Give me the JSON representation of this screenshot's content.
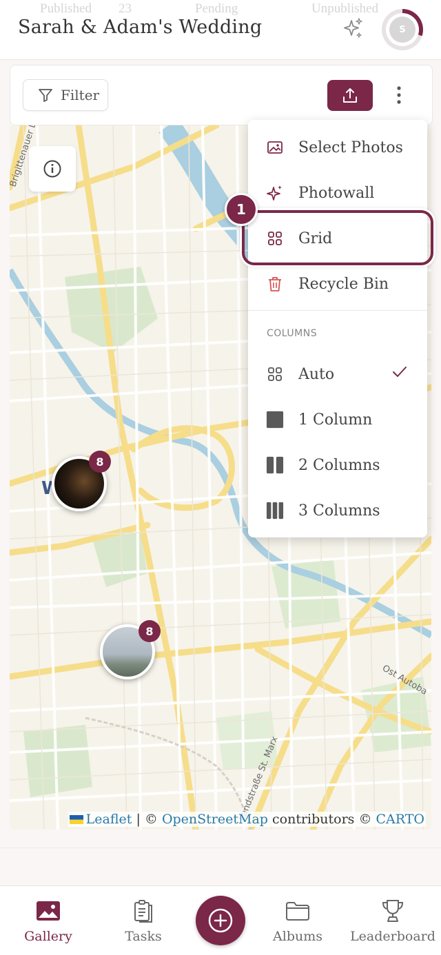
{
  "faded_tabs": {
    "published": "Published",
    "published_count": "23",
    "pending": "Pending",
    "unpublished": "Unpublished"
  },
  "header": {
    "title": "Sarah & Adam's Wedding",
    "avatar_initial": "S"
  },
  "toolbar": {
    "filter_label": "Filter"
  },
  "menu": {
    "items": [
      {
        "label": "Select Photos",
        "icon": "image-icon"
      },
      {
        "label": "Photowall",
        "icon": "sparkles-icon"
      },
      {
        "label": "Grid",
        "icon": "grid-icon"
      },
      {
        "label": "Recycle Bin",
        "icon": "trash-icon"
      }
    ],
    "section_title": "COLUMNS",
    "columns": [
      {
        "label": "Auto",
        "icon": "grid-icon",
        "checked": true
      },
      {
        "label": "1 Column",
        "icon": "one-column-icon"
      },
      {
        "label": "2 Columns",
        "icon": "two-columns-icon"
      },
      {
        "label": "3 Columns",
        "icon": "three-columns-icon"
      }
    ]
  },
  "tutorial": {
    "step": "1"
  },
  "map": {
    "markers": [
      {
        "count": "8",
        "photo": "night-venue"
      },
      {
        "count": "8",
        "photo": "cloudy-sky"
      }
    ],
    "labels": {
      "street_1": "Brigittenauer L",
      "street_2": "Ost Autoba",
      "street_3": "Landstraße St. Marx"
    },
    "attribution": {
      "leaflet": "Leaflet",
      "sep1": " | © ",
      "osm": "OpenStreetMap",
      "contributors": " contributors © ",
      "carto": "CARTO"
    }
  },
  "bottom_nav": {
    "items": [
      {
        "label": "Gallery",
        "active": true
      },
      {
        "label": "Tasks"
      },
      {
        "label": "Albums"
      },
      {
        "label": "Leaderboard"
      }
    ]
  },
  "colors": {
    "accent": "#7a2748",
    "map_base": "#f6f3ea",
    "road": "#f6dd8a",
    "water": "#a9cfe0",
    "park": "#d3e7c2"
  }
}
